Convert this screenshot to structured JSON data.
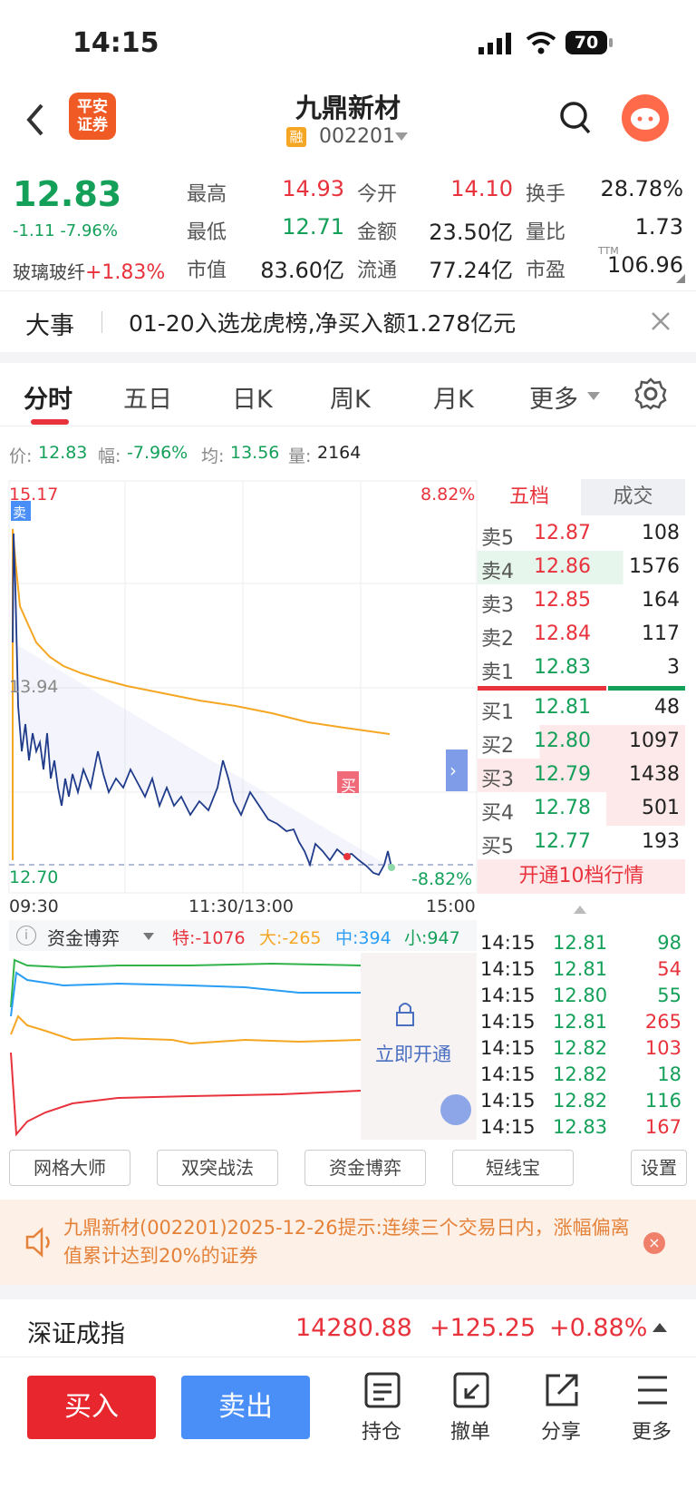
{
  "status": {
    "time": "14:15",
    "battery": "70"
  },
  "header": {
    "title": "九鼎新材",
    "code": "002201",
    "badge": "融",
    "broker": "平安\n证券",
    "broker_l1": "平安",
    "broker_l2": "证券"
  },
  "quote": {
    "price": "12.83",
    "change": "-1.11",
    "change_pct": "-7.96%",
    "sector": "玻璃玻纤",
    "sector_change": "+1.83%",
    "fields": [
      {
        "label": "最高",
        "value": "14.93"
      },
      {
        "label": "今开",
        "value": "14.10"
      },
      {
        "label": "换手",
        "value": "28.78%"
      },
      {
        "label": "最低",
        "value": "12.71"
      },
      {
        "label": "金额",
        "value": "23.50亿"
      },
      {
        "label": "量比",
        "value": "1.73"
      },
      {
        "label": "市值",
        "value": "83.60亿"
      },
      {
        "label": "流通",
        "value": "77.24亿"
      },
      {
        "label": "市盈",
        "value": "106.96",
        "sup": "TTM"
      }
    ]
  },
  "news": {
    "tag": "大事",
    "text": "01-20入选龙虎榜,净买入额1.278亿元"
  },
  "tabs": [
    "分时",
    "五日",
    "日K",
    "周K",
    "月K",
    "更多"
  ],
  "info": {
    "price_label": "价:",
    "price": "12.83",
    "amp_label": "幅:",
    "amp": "-7.96%",
    "avg_label": "均:",
    "avg": "13.56",
    "vol_label": "量:",
    "vol": "2164"
  },
  "chart": {
    "y_high": "15.17",
    "y_mid": "13.94",
    "y_low": "12.70",
    "pct_high": "8.82%",
    "pct_low": "-8.82%",
    "t_start": "09:30",
    "t_mid": "11:30/13:00",
    "t_end": "15:00",
    "sell_mark": "卖",
    "buy_mark": "买"
  },
  "fund": {
    "title": "资金博弈",
    "te": "特:-1076",
    "da": "大:-265",
    "zhong": "中:394",
    "xiao": "小:947",
    "unlock": "立即开通"
  },
  "orderbook": {
    "tab1": "五档",
    "tab2": "成交",
    "asks": [
      {
        "label": "卖5",
        "price": "12.87",
        "vol": "108"
      },
      {
        "label": "卖4",
        "price": "12.86",
        "vol": "1576"
      },
      {
        "label": "卖3",
        "price": "12.85",
        "vol": "164"
      },
      {
        "label": "卖2",
        "price": "12.84",
        "vol": "117"
      },
      {
        "label": "卖1",
        "price": "12.83",
        "vol": "3"
      }
    ],
    "bids": [
      {
        "label": "买1",
        "price": "12.81",
        "vol": "48"
      },
      {
        "label": "买2",
        "price": "12.80",
        "vol": "1097"
      },
      {
        "label": "买3",
        "price": "12.79",
        "vol": "1438"
      },
      {
        "label": "买4",
        "price": "12.78",
        "vol": "501"
      },
      {
        "label": "买5",
        "price": "12.77",
        "vol": "193"
      }
    ],
    "upgrade": "开通10档行情"
  },
  "ticks": [
    {
      "t": "14:15",
      "p": "12.81",
      "v": "98",
      "c": "green"
    },
    {
      "t": "14:15",
      "p": "12.81",
      "v": "54",
      "c": "red"
    },
    {
      "t": "14:15",
      "p": "12.80",
      "v": "55",
      "c": "green"
    },
    {
      "t": "14:15",
      "p": "12.81",
      "v": "265",
      "c": "red"
    },
    {
      "t": "14:15",
      "p": "12.82",
      "v": "103",
      "c": "red"
    },
    {
      "t": "14:15",
      "p": "12.82",
      "v": "18",
      "c": "green"
    },
    {
      "t": "14:15",
      "p": "12.82",
      "v": "116",
      "c": "green"
    },
    {
      "t": "14:15",
      "p": "12.83",
      "v": "167",
      "c": "red"
    }
  ],
  "tools": [
    "网格大师",
    "双突战法",
    "资金博弈",
    "短线宝",
    "设置"
  ],
  "alert": {
    "text": "九鼎新材(002201)2025-12-26提示:连续三个交易日内，涨幅偏离值累计达到20%的证券"
  },
  "index": {
    "name": "深证成指",
    "value": "14280.88",
    "change": "+125.25",
    "pct": "+0.88%"
  },
  "actions": {
    "buy": "买入",
    "sell": "卖出",
    "hold": "持仓",
    "cancel": "撤单",
    "share": "分享",
    "more": "更多"
  },
  "colors": {
    "red": "#e8323c",
    "green": "#15a05a",
    "blue": "#4a8ff7",
    "orange": "#f5a623"
  }
}
